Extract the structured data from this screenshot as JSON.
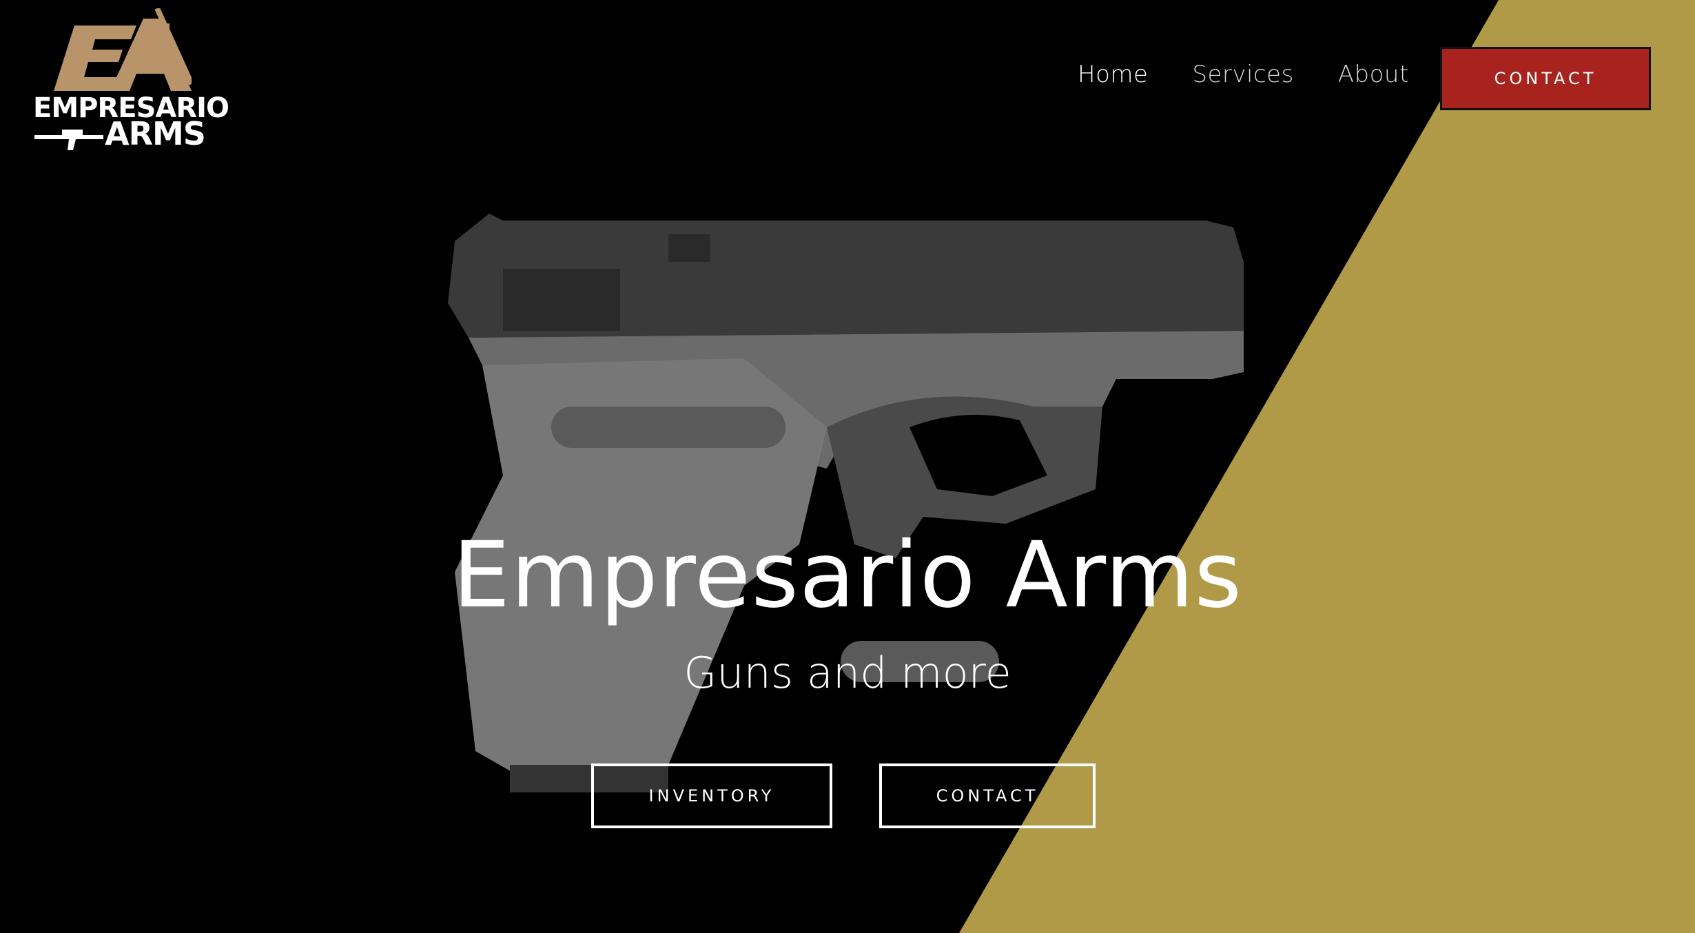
{
  "brand": {
    "logo_mark": "EA",
    "logo_line1": "EMPRESARIO",
    "logo_line2": "ARMS",
    "logo_color": "#b9946a"
  },
  "nav": {
    "items": [
      {
        "label": "Home",
        "active": true
      },
      {
        "label": "Services",
        "active": false
      },
      {
        "label": "About",
        "active": false
      }
    ],
    "cta_label": "CONTACT"
  },
  "hero": {
    "title": "Empresario Arms",
    "subtitle": "Guns and more",
    "buttons": [
      {
        "label": "INVENTORY"
      },
      {
        "label": "CONTACT"
      }
    ],
    "image": "pistol-photo"
  },
  "colors": {
    "background": "#000000",
    "accent_gold": "#b09a48",
    "cta_red": "#a8231e"
  }
}
